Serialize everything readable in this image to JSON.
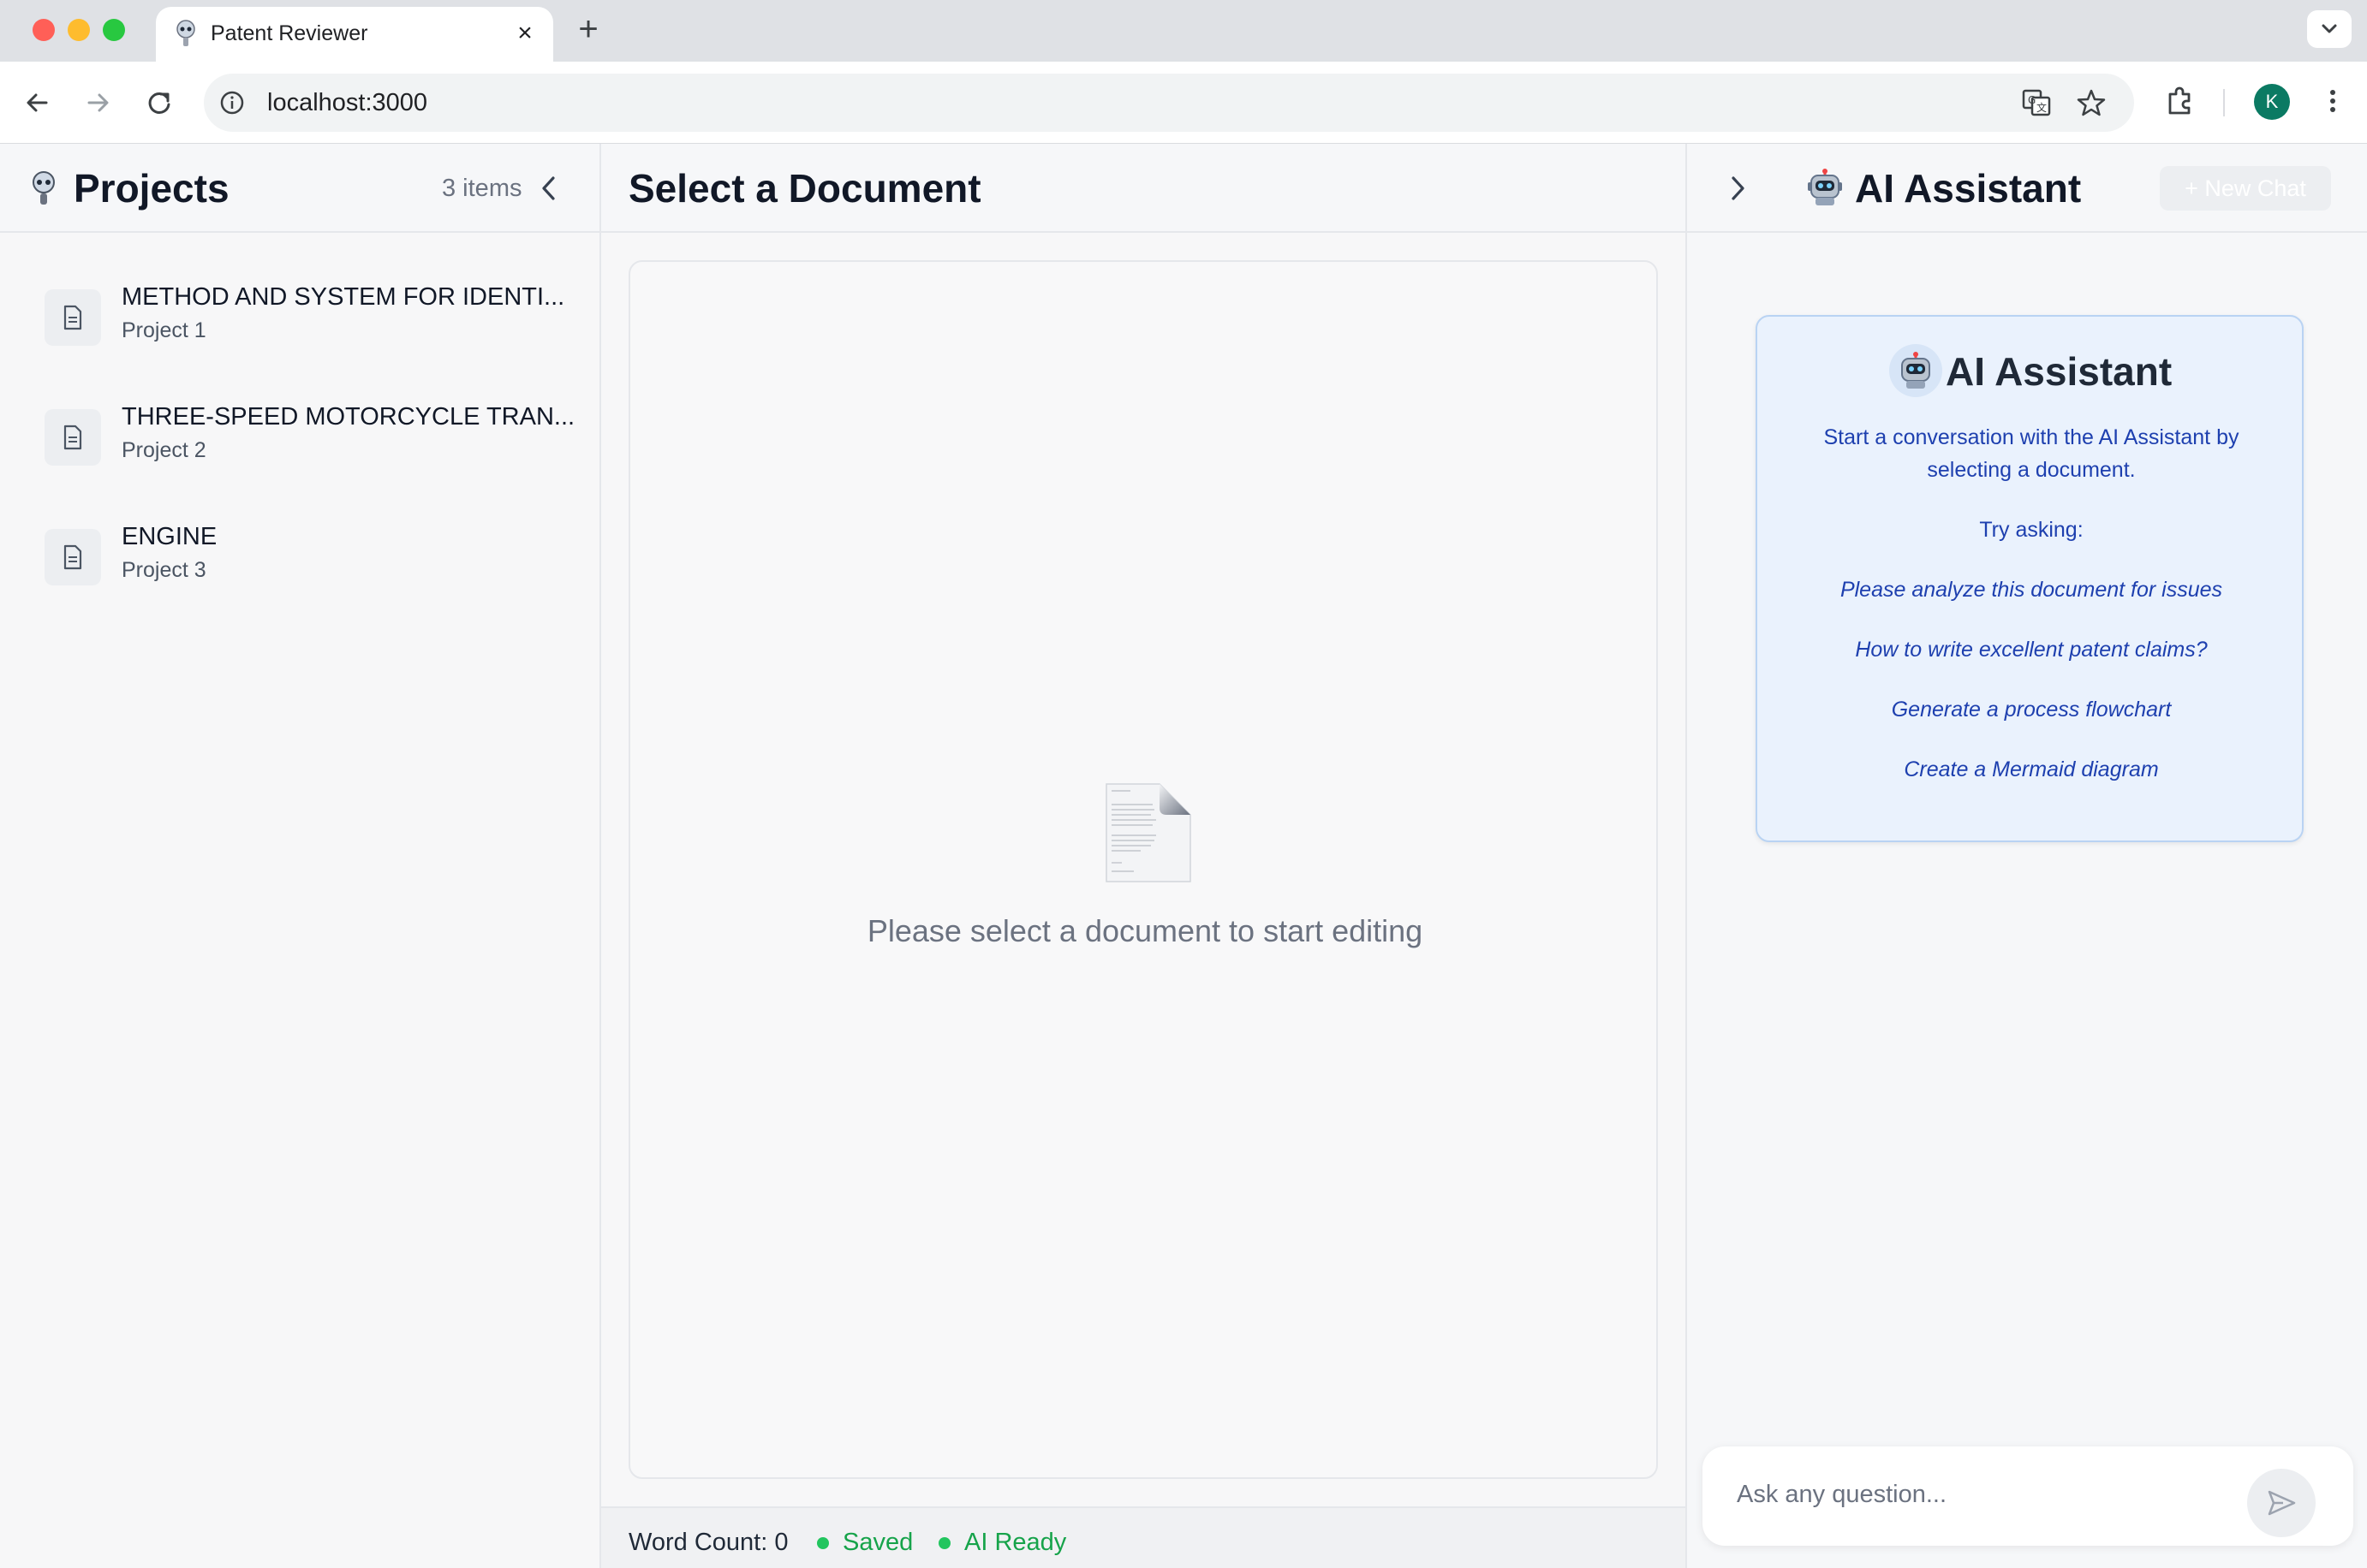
{
  "browser": {
    "tab_title": "Patent Reviewer",
    "url": "localhost:3000",
    "avatar_letter": "K",
    "icons": [
      "favicon-icon",
      "close-icon",
      "plus-icon",
      "chevron-down-icon",
      "back-icon",
      "forward-icon",
      "reload-icon",
      "info-icon",
      "translate-icon",
      "star-icon",
      "extensions-icon",
      "more-icon"
    ]
  },
  "sidebar": {
    "title": "Projects",
    "count": "3 items",
    "items": [
      {
        "name": "METHOD AND SYSTEM FOR IDENTI...",
        "sub": "Project 1"
      },
      {
        "name": "THREE-SPEED MOTORCYCLE TRAN...",
        "sub": "Project 2"
      },
      {
        "name": "ENGINE",
        "sub": "Project 3"
      }
    ]
  },
  "editor": {
    "title": "Select a Document",
    "empty_message": "Please select a document to start editing"
  },
  "status": {
    "word_count": "Word Count: 0",
    "saved": "Saved",
    "ai_ready": "AI Ready",
    "dot_color": "#22c55e",
    "text_color": "#16a34a"
  },
  "assistant": {
    "title": "AI Assistant",
    "new_chat_label": "+ New Chat",
    "welcome_title": "AI Assistant",
    "welcome_text": "Start a conversation with the AI Assistant by selecting a document.",
    "try_label": "Try asking:",
    "suggestions": [
      "Please analyze this document for issues",
      "How to write excellent patent claims?",
      "Generate a process flowchart",
      "Create a Mermaid diagram"
    ],
    "input_placeholder": "Ask any question...",
    "accent_color": "#1e40af"
  }
}
